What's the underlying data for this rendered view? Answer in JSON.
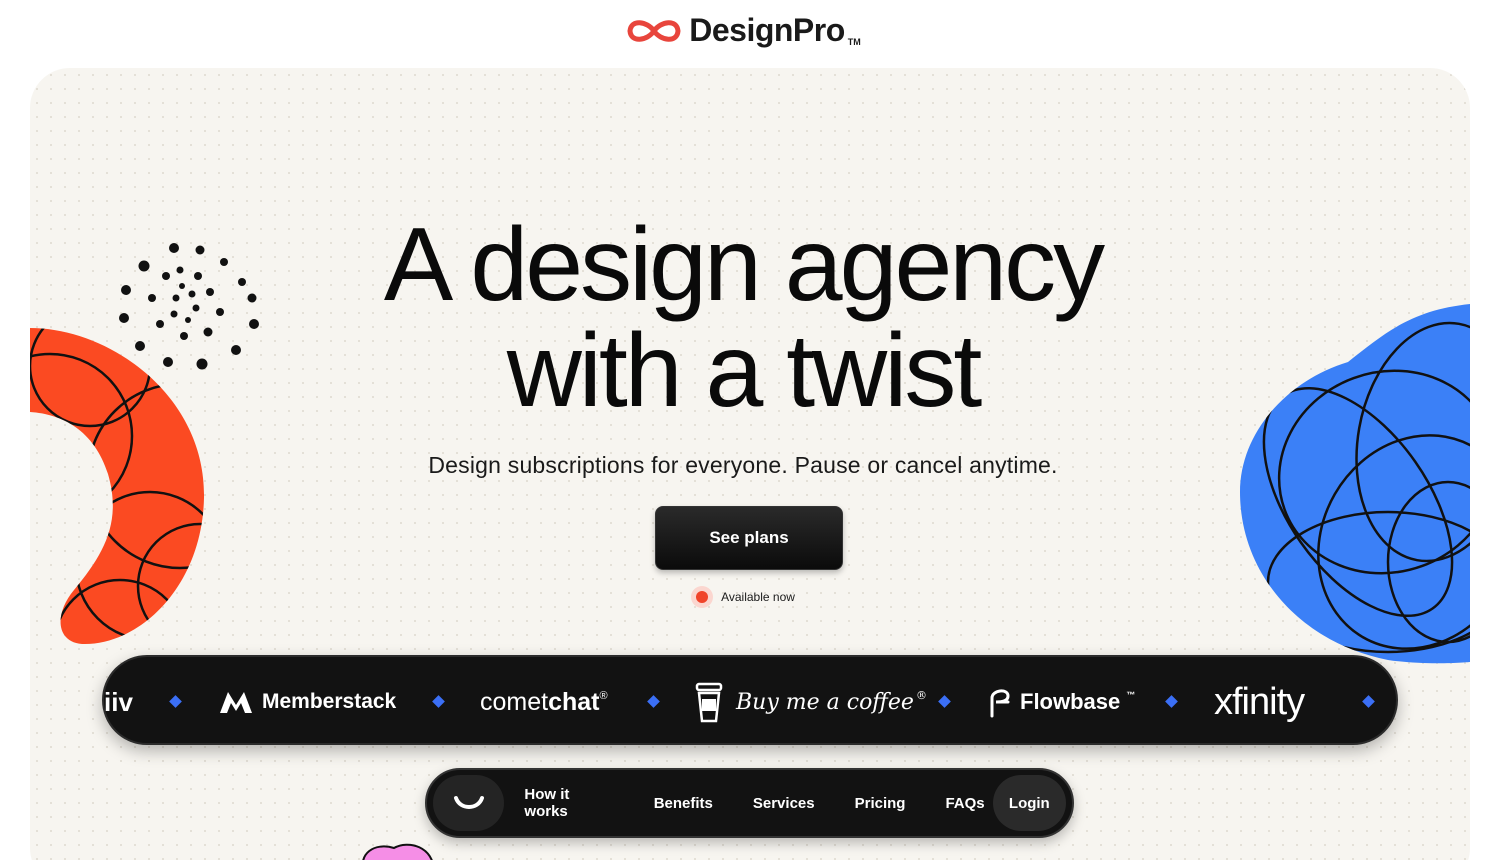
{
  "brand": {
    "name": "DesignPro",
    "tm": "TM",
    "icon": "infinity-icon",
    "color": "#e8453c"
  },
  "hero": {
    "headline_line1": "A design agency",
    "headline_line2": "with a twist",
    "subhead": "Design subscriptions for everyone. Pause or cancel anytime.",
    "cta_label": "See plans",
    "availability": "Available now"
  },
  "clients": {
    "logos": [
      {
        "name": "iiv"
      },
      {
        "name": "Memberstack",
        "icon": "memberstack-m-icon"
      },
      {
        "name_light": "comet",
        "name_bold": "chat",
        "mark": "®"
      },
      {
        "name": "Buy me a coffee",
        "icon": "coffee-cup-icon",
        "mark": "®"
      },
      {
        "name": "Flowbase",
        "icon": "flowbase-f-icon",
        "mark": "™"
      },
      {
        "name": "xfinity"
      }
    ]
  },
  "nav": {
    "logo_icon": "smile-icon",
    "links": [
      "How it works",
      "Benefits",
      "Services",
      "Pricing",
      "FAQs"
    ],
    "login": "Login"
  },
  "colors": {
    "accent_orange": "#fb4a22",
    "accent_blue": "#3b80f7",
    "accent_pink": "#f58ee6",
    "status_red": "#f0442a",
    "diamond_blue": "#3b6ff5"
  }
}
